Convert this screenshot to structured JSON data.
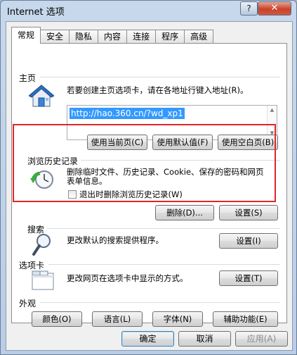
{
  "window": {
    "title": "Internet 选项",
    "help_label": "?",
    "close_label": "✕"
  },
  "tabs": [
    {
      "label": "常规",
      "active": true
    },
    {
      "label": "安全"
    },
    {
      "label": "隐私"
    },
    {
      "label": "内容"
    },
    {
      "label": "连接"
    },
    {
      "label": "程序"
    },
    {
      "label": "高级"
    }
  ],
  "homepage": {
    "title": "主页",
    "description": "若要创建主页选项卡，请在各地址行键入地址(R)。",
    "url_value": "http://hao.360.cn/?wd_xp1",
    "use_current_label": "使用当前页(C)",
    "use_default_label": "使用默认值(F)",
    "use_blank_label": "使用空白页(B)"
  },
  "history": {
    "title": "浏览历史记录",
    "description_line1": "删除临时文件、历史记录、Cookie、保存的密码和网页",
    "description_line2": "表单信息。",
    "checkbox_label": "退出时删除浏览历史记录(W)",
    "delete_label": "删除(D)...",
    "settings_label": "设置(S)"
  },
  "search": {
    "title": "搜索",
    "description": "更改默认的搜索提供程序。",
    "settings_label": "设置(I)"
  },
  "tabs_section": {
    "title": "选项卡",
    "description": "更改网页在选项卡中显示的方式。",
    "settings_label": "设置(T)"
  },
  "appearance": {
    "title": "外观",
    "colors_label": "颜色(O)",
    "languages_label": "语言(L)",
    "fonts_label": "字体(N)",
    "accessibility_label": "辅助功能(E)"
  },
  "footer": {
    "ok_label": "确定",
    "cancel_label": "取消",
    "apply_label": "应用(A)"
  },
  "colors": {
    "highlight": "#e0262a",
    "selection": "#3399ff"
  }
}
